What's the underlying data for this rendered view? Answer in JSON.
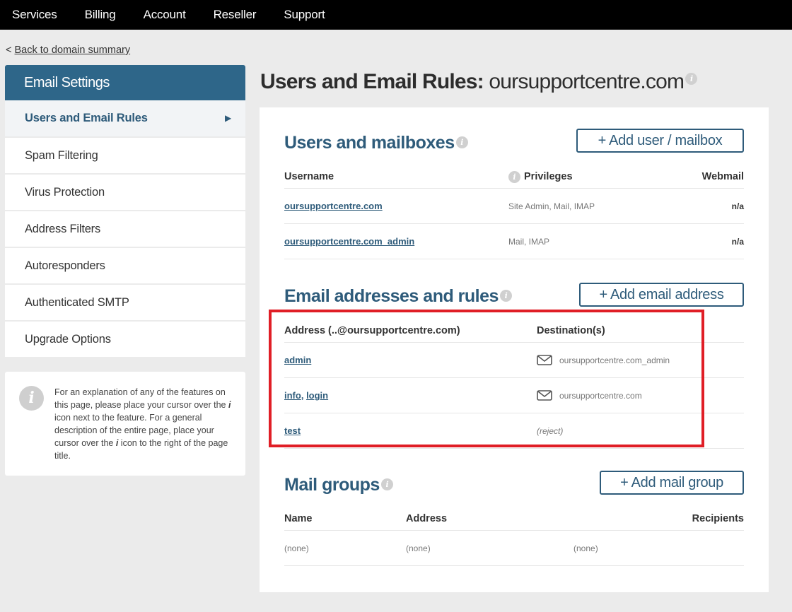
{
  "topnav": {
    "items": [
      "Services",
      "Billing",
      "Account",
      "Reseller",
      "Support"
    ]
  },
  "back_link": {
    "prefix": "<",
    "label": "Back to domain summary"
  },
  "sidebar": {
    "header": "Email Settings",
    "active_arrow": "▶",
    "items": [
      {
        "label": "Users and Email Rules",
        "active": true
      },
      {
        "label": "Spam Filtering"
      },
      {
        "label": "Virus Protection"
      },
      {
        "label": "Address Filters"
      },
      {
        "label": "Autoresponders"
      },
      {
        "label": "Authenticated SMTP"
      },
      {
        "label": "Upgrade Options"
      }
    ]
  },
  "info_box": {
    "icon": "i",
    "text_1": "For an explanation of any of the features on this page, please place your cursor over the ",
    "i_1": "i",
    "text_2": " icon next to the feature. For a general description of the entire page, place your cursor over the ",
    "i_2": "i",
    "text_3": " icon to the right of the page title."
  },
  "page": {
    "title_bold": "Users and Email Rules:",
    "title_domain": "oursupportcentre.com",
    "info_icon": "i"
  },
  "users_section": {
    "title": "Users and mailboxes",
    "add_button": "+ Add user / mailbox",
    "columns": {
      "username": "Username",
      "privileges": "Privileges",
      "webmail": "Webmail"
    },
    "rows": [
      {
        "username": "oursupportcentre.com",
        "privileges": "Site Admin, Mail, IMAP",
        "webmail": "n/a"
      },
      {
        "username": "oursupportcentre.com_admin",
        "privileges": "Mail, IMAP",
        "webmail": "n/a"
      }
    ]
  },
  "email_section": {
    "title": "Email addresses and rules",
    "add_button": "+ Add email address",
    "columns": {
      "address": "Address (..@oursupportcentre.com)",
      "destination": "Destination(s)"
    },
    "rows": [
      {
        "addresses": [
          "admin"
        ],
        "destination": "oursupportcentre.com_admin",
        "icon": "envelope-icon"
      },
      {
        "addresses": [
          "info",
          "login"
        ],
        "separator": ", ",
        "destination": "oursupportcentre.com",
        "icon": "envelope-icon"
      },
      {
        "addresses": [
          "test"
        ],
        "destination": "(reject)",
        "icon": null
      }
    ]
  },
  "groups_section": {
    "title": "Mail groups",
    "add_button": "+ Add mail group",
    "columns": {
      "name": "Name",
      "address": "Address",
      "recipients": "Recipients"
    },
    "rows": [
      {
        "name": "(none)",
        "address": "(none)",
        "recipients": "(none)"
      }
    ]
  },
  "colors": {
    "accent": "#2e6689",
    "link": "#2e5b7a",
    "highlight": "#e01e26",
    "topnav_bg": "#000000"
  }
}
